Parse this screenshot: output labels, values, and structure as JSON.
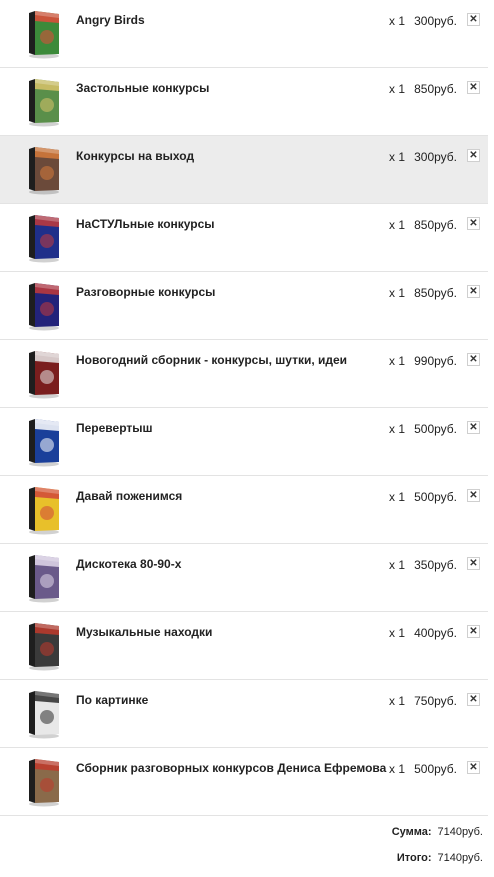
{
  "cart": {
    "items": [
      {
        "title": "Angry Birds",
        "qty": "x 1",
        "price": "300руб.",
        "cover": "#3c8a3a",
        "accent": "#e24a3b"
      },
      {
        "title": "Застольные конкурсы",
        "qty": "x 1",
        "price": "850руб.",
        "cover": "#5a8f4a",
        "accent": "#d9c36a"
      },
      {
        "title": "Конкурсы на выход",
        "qty": "x 1",
        "price": "300руб.",
        "cover": "#6b4a3a",
        "accent": "#d67a3b"
      },
      {
        "title": "НаСТУЛьные конкурсы",
        "qty": "x 1",
        "price": "850руб.",
        "cover": "#1f2f8a",
        "accent": "#c23a3a"
      },
      {
        "title": "Разговорные конкурсы",
        "qty": "x 1",
        "price": "850руб.",
        "cover": "#23237a",
        "accent": "#c23a3a"
      },
      {
        "title": "Новогодний сборник - конкурсы, шутки, идеи",
        "qty": "x 1",
        "price": "990руб.",
        "cover": "#7a1e1e",
        "accent": "#e6e6e6"
      },
      {
        "title": "Перевертыш",
        "qty": "x 1",
        "price": "500руб.",
        "cover": "#1a3f9a",
        "accent": "#ffffff"
      },
      {
        "title": "Давай поженимся",
        "qty": "x 1",
        "price": "500руб.",
        "cover": "#e8c02a",
        "accent": "#d0453a"
      },
      {
        "title": "Дискотека 80-90-х",
        "qty": "x 1",
        "price": "350руб.",
        "cover": "#6a5a8a",
        "accent": "#e0d8ea"
      },
      {
        "title": "Музыкальные находки",
        "qty": "x 1",
        "price": "400руб.",
        "cover": "#3a3a3a",
        "accent": "#c0392b"
      },
      {
        "title": "По картинке",
        "qty": "x 1",
        "price": "750руб.",
        "cover": "#e8e8e8",
        "accent": "#2b2b2b"
      },
      {
        "title": "Сборник разговорных конкурсов Дениса Ефремова",
        "qty": "x 1",
        "price": "500руб.",
        "cover": "#8a6a4a",
        "accent": "#c0392b"
      }
    ],
    "active_index": 2
  },
  "totals": {
    "sum_label": "Сумма:",
    "sum_value": "7140руб.",
    "total_label": "Итого:",
    "total_value": "7140руб."
  },
  "icons": {
    "remove": "close-icon",
    "thumb": "dvd-cover-icon"
  }
}
